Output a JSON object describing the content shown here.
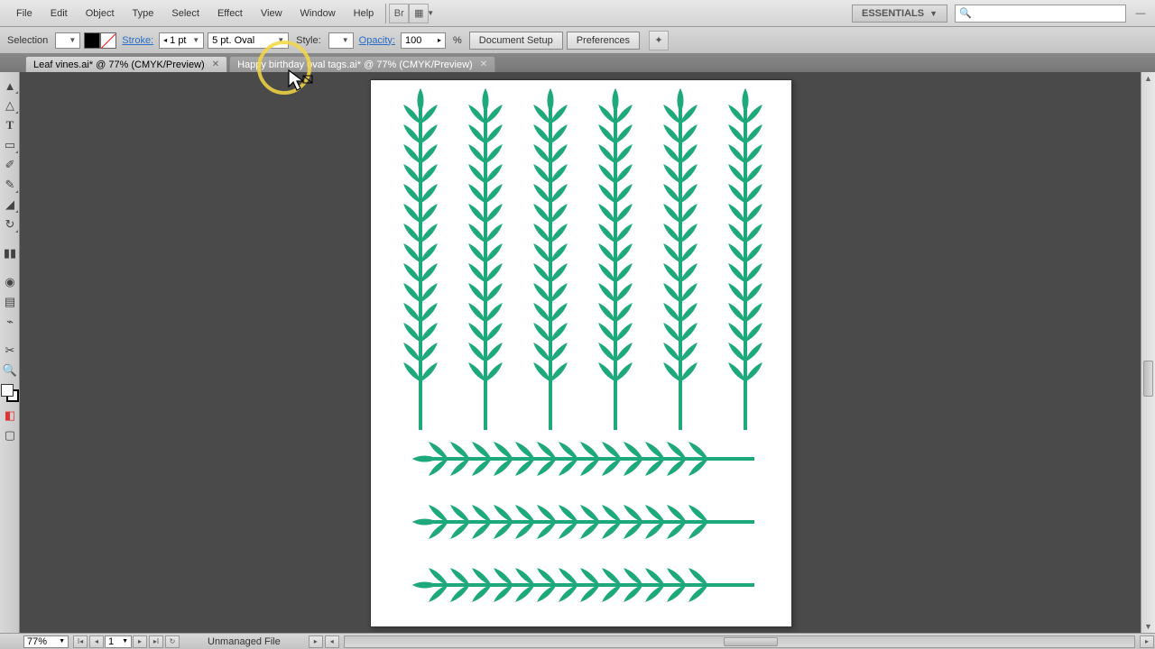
{
  "menu": {
    "file": "File",
    "edit": "Edit",
    "object": "Object",
    "type": "Type",
    "select": "Select",
    "effect": "Effect",
    "view": "View",
    "window": "Window",
    "help": "Help"
  },
  "workspace_label": "ESSENTIALS",
  "control": {
    "selection": "Selection",
    "stroke": "Stroke:",
    "stroke_weight": "1 pt",
    "brush": "5 pt. Oval",
    "style": "Style:",
    "opacity": "Opacity:",
    "opacity_val": "100",
    "percent": "%",
    "doc_setup": "Document Setup",
    "prefs": "Preferences"
  },
  "tabs": [
    {
      "label": "Leaf vines.ai* @ 77% (CMYK/Preview)",
      "active": false
    },
    {
      "label": "Happy birthday oval tags.ai* @ 77% (CMYK/Preview)",
      "active": true
    }
  ],
  "status": {
    "zoom": "77%",
    "artboard": "1",
    "file_status": "Unmanaged File"
  },
  "colors": {
    "leaf": "#1ea97c"
  }
}
